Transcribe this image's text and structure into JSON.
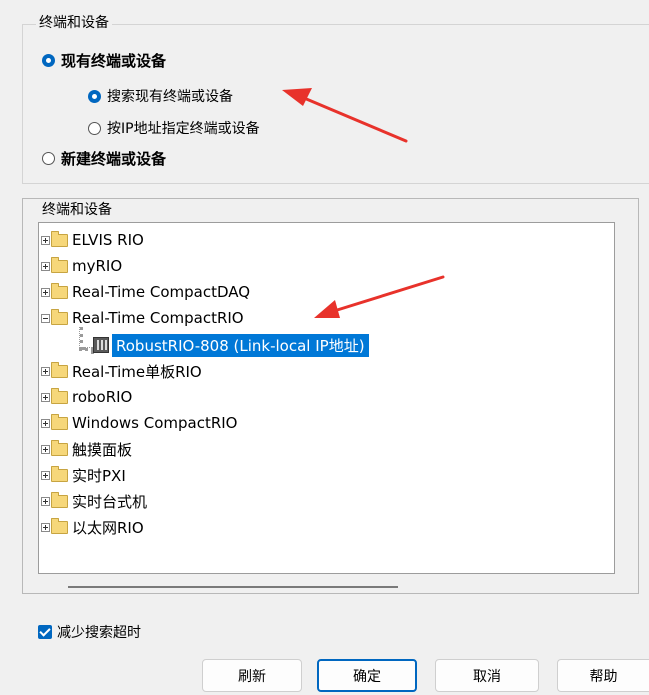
{
  "target_group": {
    "title": "终端和设备",
    "existing_label": "现有终端或设备",
    "search_label": "搜索现有终端或设备",
    "by_ip_label": "按IP地址指定终端或设备",
    "new_label": "新建终端或设备"
  },
  "tree": {
    "title": "终端和设备",
    "nodes": [
      {
        "label": "ELVIS RIO"
      },
      {
        "label": "myRIO"
      },
      {
        "label": "Real-Time CompactDAQ"
      },
      {
        "label": "Real-Time CompactRIO"
      },
      {
        "label": "RobustRIO-808  (Link-local IP地址)"
      },
      {
        "label": "Real-Time单板RIO"
      },
      {
        "label": "roboRIO"
      },
      {
        "label": "Windows CompactRIO"
      },
      {
        "label": "触摸面板"
      },
      {
        "label": "实时PXI"
      },
      {
        "label": "实时台式机"
      },
      {
        "label": "以太网RIO"
      }
    ]
  },
  "options": {
    "reduce_timeout_label": "减少搜索超时"
  },
  "buttons": {
    "refresh": "刷新",
    "ok": "确定",
    "cancel": "取消",
    "help": "帮助"
  },
  "colors": {
    "accent": "#0067c0",
    "selection": "#0078d7",
    "annotation_arrow": "#e8322b"
  }
}
